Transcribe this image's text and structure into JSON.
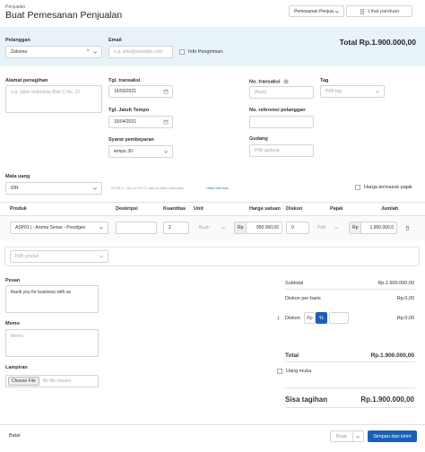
{
  "header": {
    "breadcrumb": "Penjualan",
    "title": "Buat Pemesanan Penjualan",
    "doc_type_select": "Pemesanan Penjua...",
    "guide_button": "Lihat panduan"
  },
  "customer": {
    "label": "Pelanggan",
    "value": "Zaloona",
    "email_label": "Email",
    "email_placeholder": "e.g. john@example.com",
    "shipping_info_label": "Info Pengiriman",
    "total_label": "Total Rp.1.900.000,00"
  },
  "form": {
    "billing_label": "Alamat penagihan",
    "billing_placeholder": "e.g. Jalan Indonesia Blok C No. 22",
    "tx_date_label": "Tgl. transaksi",
    "tx_date_value": "16/03/2021",
    "due_date_label": "Tgl. Jatuh Tempo",
    "due_date_value": "15/04/2021",
    "terms_label": "Syarat pembayaran",
    "terms_value": "tempo 30",
    "tx_no_label": "No. transaksi",
    "tx_no_placeholder": "[Auto]",
    "tag_label": "Tag",
    "tag_placeholder": "Pilih tag",
    "ref_label": "No. referensi pelanggan",
    "warehouse_label": "Gudang",
    "warehouse_placeholder": "Pilih gudang",
    "currency_label": "Mata uang",
    "currency_value": "IDR",
    "rate_text": "SGD$ 1 = Rp.14.371,01 rate by Bank Indonesia",
    "rate_link": "Ubah nilai kurs",
    "tax_inclusive_label": "Harga termasuk pajak"
  },
  "table": {
    "headers": {
      "product": "Produk",
      "description": "Deskripsi",
      "quantity": "Kuantitas",
      "unit": "Unit",
      "unit_price": "Harga satuan",
      "discount": "Diskon",
      "tax": "Pajak",
      "amount": "Jumlah"
    },
    "rows": [
      {
        "product": "ASP01 | - Aroma Sense - Prestiges",
        "description": "",
        "quantity": "2",
        "unit": "Buah",
        "currency": "Rp",
        "unit_price": "950.000,00",
        "discount": "0",
        "tax": "Pilih",
        "amount_currency": "Rp",
        "amount": "1.900.000,0"
      }
    ],
    "add_product_placeholder": "Pilih produk"
  },
  "message": {
    "label": "Pesan",
    "value": "thank you  for business with us"
  },
  "memo": {
    "label": "Memo",
    "placeholder": "Memo"
  },
  "attachment": {
    "label": "Lampiran",
    "choose_button": "Choose File",
    "status": "No file chosen"
  },
  "summary": {
    "subtotal_label": "Subtotal",
    "subtotal_value": "Rp.1.900.000,00",
    "discount_per_line_label": "Diskon per baris",
    "discount_per_line_value": "Rp.0,00",
    "discount_label": "Diskon",
    "discount_rp": "Rp",
    "discount_pct": "%",
    "discount_value": "Rp.0,00",
    "total_label": "Total",
    "total_value": "Rp.1.900.000,00",
    "down_payment_label": "Uang muka",
    "balance_label": "Sisa tagihan",
    "balance_value": "Rp.1.900.000,00"
  },
  "footer": {
    "cancel": "Batal",
    "create": "Buat",
    "save_send": "Simpan dan kirim"
  },
  "colors": {
    "primary": "#1a5fb4",
    "band": "#e7f3f9",
    "link": "#2a7ab8"
  }
}
